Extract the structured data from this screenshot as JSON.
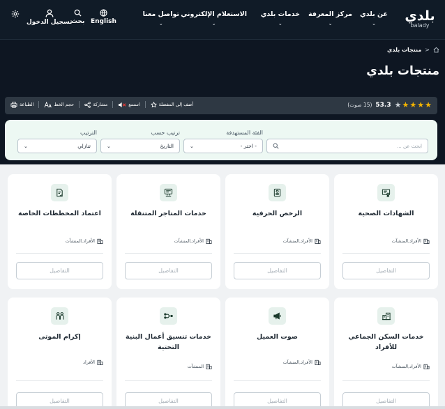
{
  "logo": {
    "ar": "بلدي",
    "en": "balady"
  },
  "nav": {
    "items": [
      {
        "label": "عن بلدي"
      },
      {
        "label": "مركز المعرفة"
      },
      {
        "label": "خدمات بلدي"
      },
      {
        "label": "الاستعلام الإلكتروني"
      },
      {
        "label": "تواصل معنا"
      }
    ],
    "language": "English",
    "search": "بحث",
    "login": "تسجيل الدخول",
    "chevron": "⌄"
  },
  "breadcrumb": {
    "home_icon": "home-icon",
    "separator": "<",
    "current": "منتجات بلدي"
  },
  "page_title": "منتجات بلدي",
  "rating": {
    "score": "53.3",
    "votes": "(15 صوت)",
    "stars_on": 4,
    "stars_total": 5,
    "star_color": "#f4b400"
  },
  "tools": {
    "favorite": "أضف إلى المفضلة",
    "listen": "استمع",
    "share": "مشاركة",
    "font_size": "حجم الخط",
    "print": "الطباعة"
  },
  "filters": {
    "search_placeholder": "ابحث عن ...",
    "target_label": "الفئة المستهدفة",
    "target_value": "- اختر -",
    "sort_by_label": "ترتيب حسب",
    "sort_by_value": "التاريخ",
    "order_label": "الترتيب",
    "order_value": "تنازلي"
  },
  "cards": [
    {
      "title": "الشهادات الصحية",
      "audience": "الأفراد,المنشآت",
      "icon": "certificate-icon",
      "details": "التفاصيل"
    },
    {
      "title": "الرخص الحرفية",
      "audience": "الأفراد,المنشآت",
      "icon": "license-icon",
      "details": "التفاصيل"
    },
    {
      "title": "خدمات المتاجر المتنقلة",
      "audience": "الأفراد,المنشآت",
      "icon": "mobile-store-icon",
      "details": "التفاصيل"
    },
    {
      "title": "اعتماد المخططات الخاصة",
      "audience": "الأفراد,المنشآت",
      "icon": "plan-approval-icon",
      "details": "التفاصيل"
    },
    {
      "title": "خدمات السكن الجماعي للأفراد",
      "audience": "الأفراد,المنشآت",
      "icon": "housing-icon",
      "details": "التفاصيل"
    },
    {
      "title": "صوت العميل",
      "audience": "الأفراد,المنشآت",
      "icon": "megaphone-icon",
      "details": "التفاصيل"
    },
    {
      "title": "خدمات تنسيق أعمال البنية التحتية",
      "audience": "المنشآت",
      "icon": "infrastructure-icon",
      "details": "التفاصيل"
    },
    {
      "title": "إكرام الموتى",
      "audience": "الأفراد",
      "icon": "people-icon",
      "details": "التفاصيل"
    }
  ],
  "colors": {
    "brand_green": "#1b8354",
    "header_bg": "#101b27",
    "filter_bg": "#edf8f3"
  }
}
